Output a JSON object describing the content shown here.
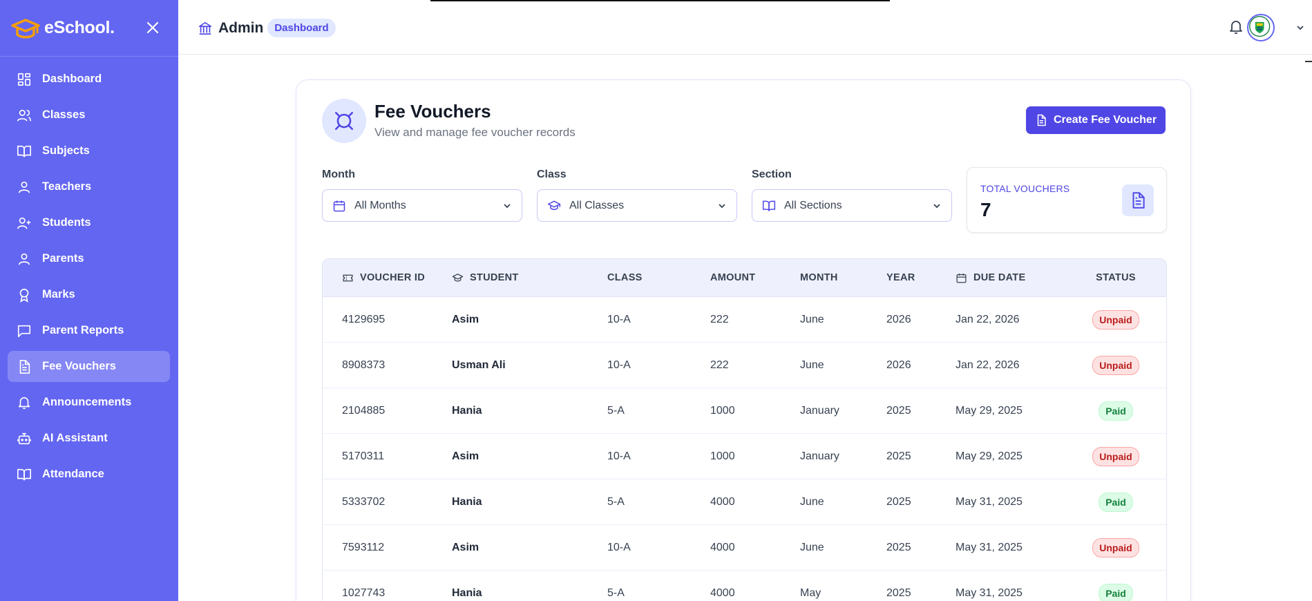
{
  "brand": {
    "name": "eSchool."
  },
  "sidebar": {
    "items": [
      {
        "label": "Dashboard",
        "icon": "grid-icon",
        "active": false
      },
      {
        "label": "Classes",
        "icon": "users-icon",
        "active": false
      },
      {
        "label": "Subjects",
        "icon": "book-icon",
        "active": false
      },
      {
        "label": "Teachers",
        "icon": "user-icon",
        "active": false
      },
      {
        "label": "Students",
        "icon": "user-plus-icon",
        "active": false
      },
      {
        "label": "Parents",
        "icon": "user-icon",
        "active": false
      },
      {
        "label": "Marks",
        "icon": "award-icon",
        "active": false
      },
      {
        "label": "Parent Reports",
        "icon": "message-icon",
        "active": false
      },
      {
        "label": "Fee Vouchers",
        "icon": "file-text-icon",
        "active": true
      },
      {
        "label": "Announcements",
        "icon": "bell-icon",
        "active": false
      },
      {
        "label": "AI Assistant",
        "icon": "bot-icon",
        "active": false
      },
      {
        "label": "Attendance",
        "icon": "book-icon",
        "active": false
      }
    ]
  },
  "topbar": {
    "title": "Admin",
    "badge": "Dashboard"
  },
  "page": {
    "title": "Fee Vouchers",
    "subtitle": "View and manage fee voucher records",
    "create_label": "Create Fee Voucher"
  },
  "filters": {
    "month": {
      "label": "Month",
      "value": "All Months"
    },
    "class": {
      "label": "Class",
      "value": "All Classes"
    },
    "section": {
      "label": "Section",
      "value": "All Sections"
    }
  },
  "total": {
    "label": "TOTAL VOUCHERS",
    "value": "7"
  },
  "table": {
    "headers": [
      "VOUCHER ID",
      "STUDENT",
      "CLASS",
      "AMOUNT",
      "MONTH",
      "YEAR",
      "DUE DATE",
      "STATUS"
    ],
    "rows": [
      {
        "id": "4129695",
        "student": "Asim",
        "class": "10-A",
        "amount": "222",
        "month": "June",
        "year": "2026",
        "due": "Jan 22, 2026",
        "status": "Unpaid"
      },
      {
        "id": "8908373",
        "student": "Usman Ali",
        "class": "10-A",
        "amount": "222",
        "month": "June",
        "year": "2026",
        "due": "Jan 22, 2026",
        "status": "Unpaid"
      },
      {
        "id": "2104885",
        "student": "Hania",
        "class": "5-A",
        "amount": "1000",
        "month": "January",
        "year": "2025",
        "due": "May 29, 2025",
        "status": "Paid"
      },
      {
        "id": "5170311",
        "student": "Asim",
        "class": "10-A",
        "amount": "1000",
        "month": "January",
        "year": "2025",
        "due": "May 29, 2025",
        "status": "Unpaid"
      },
      {
        "id": "5333702",
        "student": "Hania",
        "class": "5-A",
        "amount": "4000",
        "month": "June",
        "year": "2025",
        "due": "May 31, 2025",
        "status": "Paid"
      },
      {
        "id": "7593112",
        "student": "Asim",
        "class": "10-A",
        "amount": "4000",
        "month": "June",
        "year": "2025",
        "due": "May 31, 2025",
        "status": "Unpaid"
      },
      {
        "id": "1027743",
        "student": "Hania",
        "class": "5-A",
        "amount": "4000",
        "month": "May",
        "year": "2025",
        "due": "May 31, 2025",
        "status": "Paid"
      }
    ]
  },
  "colors": {
    "accent": "#6366f1",
    "primary_button": "#4f46e5",
    "unpaid": "#b91c1c",
    "paid": "#15803d"
  }
}
